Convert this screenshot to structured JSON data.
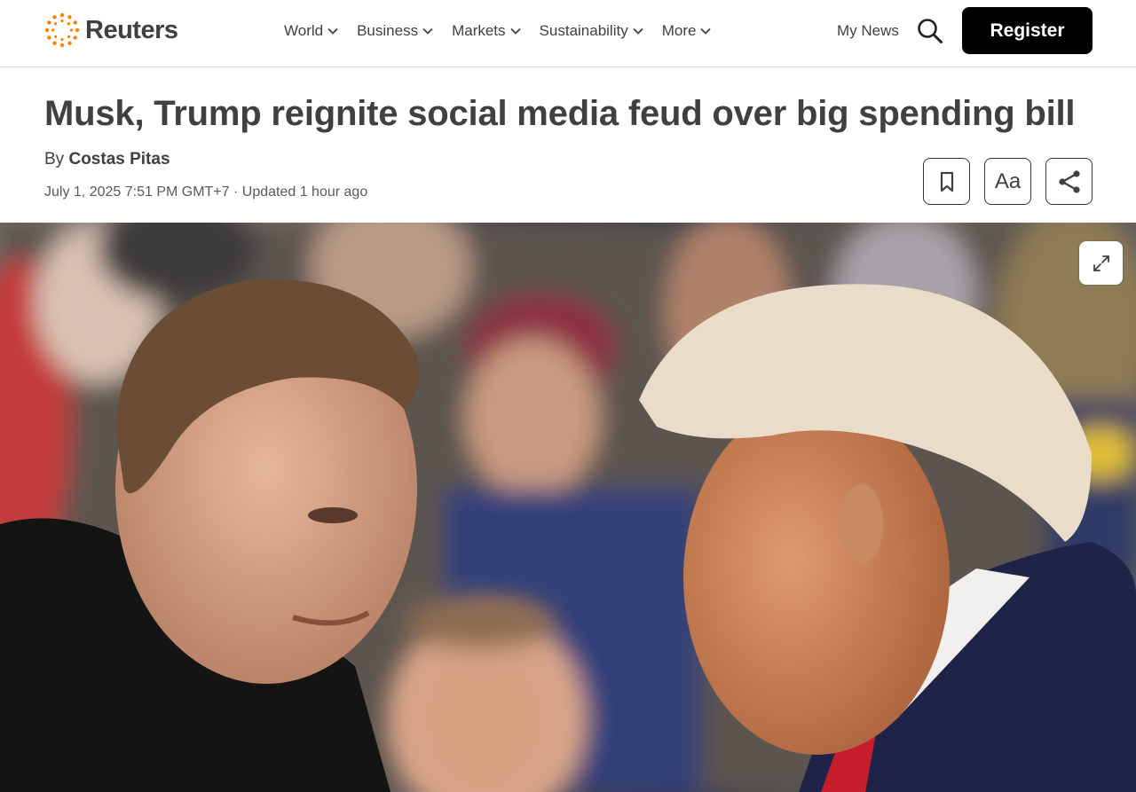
{
  "site": {
    "brand": "Reuters",
    "accent_color": "#ff8000"
  },
  "nav": {
    "items": [
      {
        "label": "World",
        "icon": "chevron-down-icon"
      },
      {
        "label": "Business",
        "icon": "chevron-down-icon"
      },
      {
        "label": "Markets",
        "icon": "chevron-down-icon"
      },
      {
        "label": "Sustainability",
        "icon": "chevron-down-icon"
      },
      {
        "label": "More",
        "icon": "chevron-down-icon"
      }
    ],
    "my_news": "My News",
    "search_icon": "search-icon",
    "register": "Register"
  },
  "article": {
    "headline": "Musk, Trump reignite social media feud over big spending bill",
    "by_prefix": "By",
    "author": "Costas Pitas",
    "dateline": "July 1, 2025 7:51 PM GMT+7 · Updated 1 hour ago",
    "tools": {
      "bookmark_icon": "bookmark-icon",
      "text_size_label": "Aa",
      "share_icon": "share-icon"
    },
    "photo": {
      "expand_icon": "expand-icon"
    }
  }
}
